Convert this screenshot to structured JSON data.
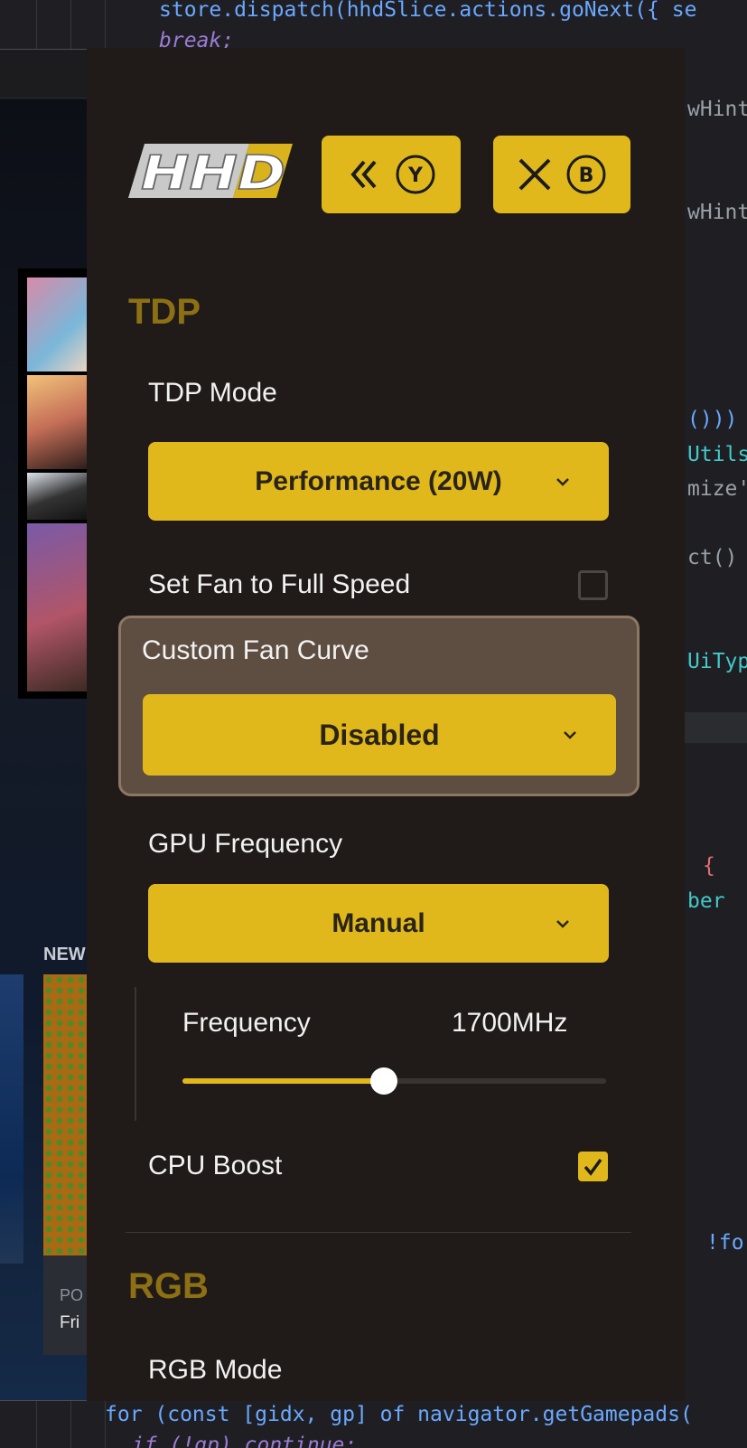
{
  "editor": {
    "lines": [
      {
        "text": "store.dispatch(hhdSlice.actions.goNext({ se",
        "color": "#6aa8ff"
      },
      {
        "text": "break;",
        "color": "#9c7bd3"
      },
      {
        "text": "wHint",
        "color": "#9aa0a8"
      },
      {
        "text": "wHint",
        "color": "#9aa0a8"
      },
      {
        "text": "()))",
        "color": "#6aa8ff"
      },
      {
        "text": "Utils",
        "color": "#44c8c8"
      },
      {
        "text": "mize'",
        "color": "#9aa0a8"
      },
      {
        "text": "ct()",
        "color": "#9aa0a8"
      },
      {
        "text": "UiTyp",
        "color": "#44c8c8"
      },
      {
        "text": "{",
        "color": "#e06c75"
      },
      {
        "text": "ber",
        "color": "#44c8c8"
      },
      {
        "text": "!fo",
        "color": "#6aa8ff"
      },
      {
        "text": "for (const [gidx, gp] of navigator.getGamepads(",
        "color": "#6aa8ff"
      },
      {
        "text": "if (!gp) continue;",
        "color": "#9c7bd3"
      }
    ]
  },
  "host": {
    "new_label": "NEW",
    "caption_1": "PO",
    "caption_2": "Fri"
  },
  "panel": {
    "logo_text": "HHD",
    "back_button": {
      "icon": "double-chevron-left-icon",
      "badge": "Y"
    },
    "close_button": {
      "icon": "close-icon",
      "badge": "B"
    },
    "tdp": {
      "title": "TDP",
      "mode_label": "TDP Mode",
      "mode_value": "Performance (20W)",
      "fan_full_label": "Set Fan to Full Speed",
      "fan_full_checked": false,
      "fan_curve_label": "Custom Fan Curve",
      "fan_curve_value": "Disabled",
      "gpu_label": "GPU Frequency",
      "gpu_value": "Manual",
      "freq_label": "Frequency",
      "freq_value": "1700MHz",
      "freq_level": 0.475,
      "cpu_boost_label": "CPU Boost",
      "cpu_boost_checked": true
    },
    "rgb": {
      "title": "RGB",
      "mode_label": "RGB Mode"
    }
  },
  "colors": {
    "accent": "#e0b81c",
    "panel_bg": "#201b18",
    "section_title": "#8d7014",
    "highlight": "#5e4e41"
  }
}
